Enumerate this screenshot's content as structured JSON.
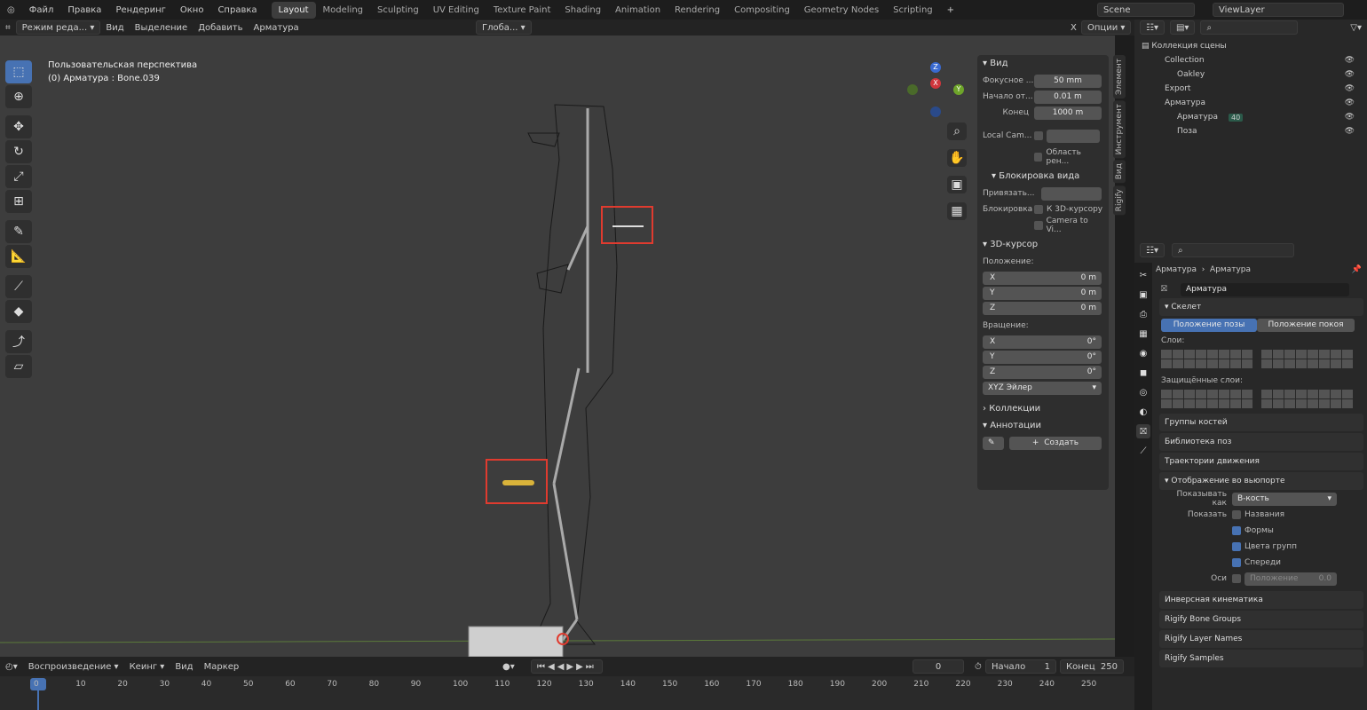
{
  "menu": [
    "Файл",
    "Правка",
    "Рендеринг",
    "Окно",
    "Справка"
  ],
  "workspaces": [
    "Layout",
    "Modeling",
    "Sculpting",
    "UV Editing",
    "Texture Paint",
    "Shading",
    "Animation",
    "Rendering",
    "Compositing",
    "Geometry Nodes",
    "Scripting"
  ],
  "active_workspace": "Layout",
  "scene": "Scene",
  "viewlayer": "ViewLayer",
  "vp_header": {
    "mode": "Режим реда...",
    "items": [
      "Вид",
      "Выделение",
      "Добавить",
      "Арматура"
    ],
    "transform": "Глоба...",
    "options": "Опции"
  },
  "viewport": {
    "line1": "Пользовательская перспектива",
    "line2": "(0) Арматура : Bone.039"
  },
  "axes": {
    "z": "Z",
    "y": "Y",
    "x": "X"
  },
  "npanel": {
    "view_caption": "Вид",
    "focal_label": "Фокусное ...",
    "focal": "50 mm",
    "clip_start_label": "Начало от...",
    "clip_start": "0.01 m",
    "clip_end_label": "Конец",
    "clip_end": "1000 m",
    "local_cam": "Local Cam...",
    "render_region": "Область рен...",
    "lock_caption": "Блокировка вида",
    "lock_to": "Привязать...",
    "lock_label": "Блокировка",
    "lock_cursor": "К 3D-курсору",
    "camera_to": "Camera to Vi...",
    "cursor_caption": "3D-курсор",
    "position": "Положение:",
    "pos": [
      {
        "a": "X",
        "v": "0 m"
      },
      {
        "a": "Y",
        "v": "0 m"
      },
      {
        "a": "Z",
        "v": "0 m"
      }
    ],
    "rotation": "Вращение:",
    "rot": [
      {
        "a": "X",
        "v": "0°"
      },
      {
        "a": "Y",
        "v": "0°"
      },
      {
        "a": "Z",
        "v": "0°"
      }
    ],
    "euler": "XYZ Эйлер",
    "collections": "Коллекции",
    "annotations": "Аннотации",
    "create": "Создать"
  },
  "ntabs": [
    "Элемент",
    "Инструмент",
    "Вид",
    "Rigify"
  ],
  "outliner": {
    "title": "Коллекция сцены",
    "rows": [
      {
        "l": "Collection",
        "d": 1
      },
      {
        "l": "Oakley",
        "d": 2
      },
      {
        "l": "Export",
        "d": 1
      },
      {
        "l": "Арматура",
        "d": 1
      },
      {
        "l": "Арматура",
        "d": 2,
        "badge": "40"
      },
      {
        "l": "Поза",
        "d": 2
      }
    ]
  },
  "props": {
    "breadcrumb_a": "Арматура",
    "breadcrumb_b": "Арматура",
    "name": "Арматура",
    "skeleton": "Скелет",
    "pose_pos": "Положение позы",
    "rest_pos": "Положение покоя",
    "layers": "Слои:",
    "protected": "Защищённые слои:",
    "sections_a": [
      "Группы костей",
      "Библиотека поз",
      "Траектории движения"
    ],
    "viewport_display": "Отображение во вьюпорте",
    "show_as_label": "Показывать как",
    "show_as": "В-кость",
    "show_label": "Показать",
    "checks": [
      {
        "l": "Названия",
        "on": false
      },
      {
        "l": "Формы",
        "on": true
      },
      {
        "l": "Цвета групп",
        "on": true
      },
      {
        "l": "Спереди",
        "on": true
      }
    ],
    "axes_label": "Оси",
    "axes_pos": "Положение",
    "axes_val": "0.0",
    "sections_b": [
      "Инверсная кинематика",
      "Rigify Bone Groups",
      "Rigify Layer Names",
      "Rigify Samples"
    ]
  },
  "timeline": {
    "playback": "Воспроизведение",
    "keying": "Кеинг",
    "view": "Вид",
    "marker": "Маркер",
    "frame": "0",
    "start_label": "Начало",
    "start": "1",
    "end_label": "Конец",
    "end": "250",
    "ticks": [
      "0",
      "10",
      "20",
      "30",
      "40",
      "50",
      "60",
      "70",
      "80",
      "90",
      "100",
      "110",
      "120",
      "130",
      "140",
      "150",
      "160",
      "170",
      "180",
      "190",
      "200",
      "210",
      "220",
      "230",
      "240",
      "250"
    ]
  }
}
